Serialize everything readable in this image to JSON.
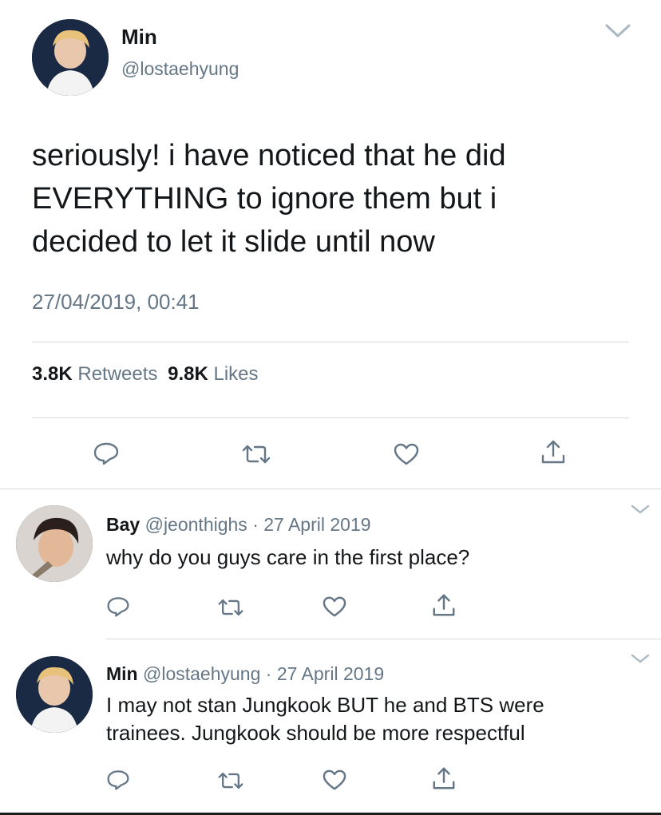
{
  "main_tweet": {
    "author_name": "Min",
    "author_handle": "@lostaehyung",
    "text_lines": [
      "seriously! i have noticed that he did",
      "EVERYTHING to ignore them but i",
      "decided to let it slide until now"
    ],
    "timestamp": "27/04/2019, 00:41",
    "retweet_count": "3.8K",
    "retweet_label": "Retweets",
    "like_count": "9.8K",
    "like_label": "Likes"
  },
  "replies": [
    {
      "author_name": "Bay",
      "author_handle": "@jeonthighs",
      "separator": "·",
      "date": "27 April 2019",
      "text_lines": [
        "why do you guys care in the first place?"
      ]
    },
    {
      "author_name": "Min",
      "author_handle": "@lostaehyung",
      "separator": "·",
      "date": "27 April 2019",
      "text_lines": [
        "I may not stan Jungkook BUT he and BTS were",
        "trainees. Jungkook should be more respectful"
      ]
    }
  ],
  "icons": [
    "reply-icon",
    "retweet-icon",
    "like-icon",
    "share-icon",
    "chevron-down-icon"
  ],
  "colors": {
    "text": "#14171a",
    "muted": "#657786",
    "icon": "#657786",
    "divider": "#d6dbe0"
  }
}
